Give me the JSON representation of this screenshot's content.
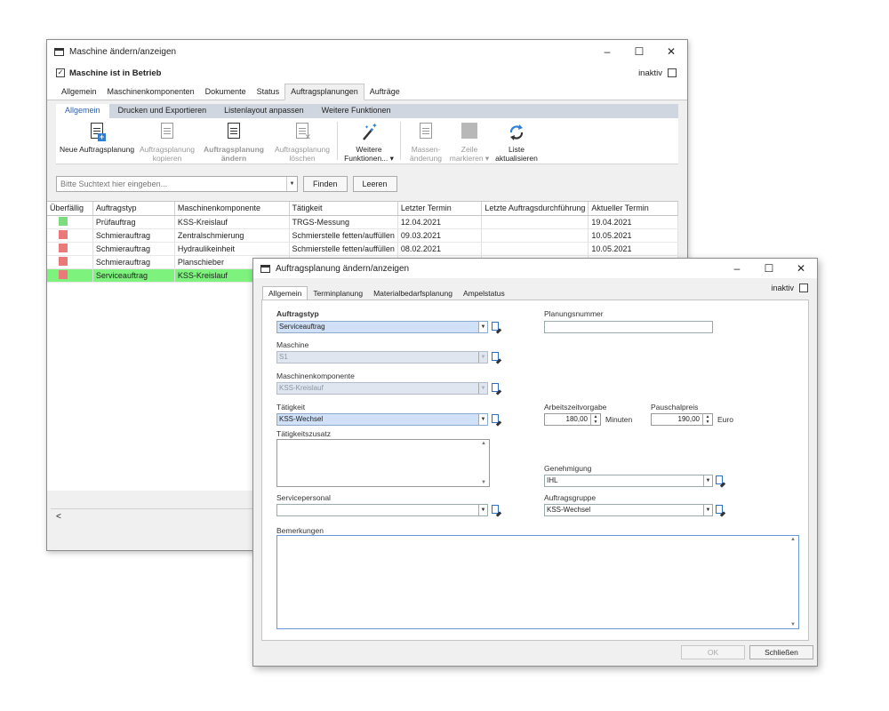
{
  "back": {
    "title": "Maschine ändern/anzeigen",
    "controls": {
      "minimize": "–",
      "maximize": "☐",
      "close": "✕"
    },
    "checkbox_label": "Maschine ist in Betrieb",
    "checkbox_checked": true,
    "inaktiv_label": "inaktiv",
    "main_tabs": [
      "Allgemein",
      "Maschinenkomponenten",
      "Dokumente",
      "Status",
      "Auftragsplanungen",
      "Aufträge"
    ],
    "main_tab_active": "Auftragsplanungen",
    "sub_tabs": [
      "Allgemein",
      "Drucken und Exportieren",
      "Listenlayout anpassen",
      "Weitere Funktionen"
    ],
    "toolbar": {
      "neue_line1": "Neue Auftragsplanung",
      "kopieren_line1": "Auftragsplanung",
      "kopieren_line2": "kopieren",
      "aendern_line1": "Auftragsplanung",
      "aendern_line2": "ändern",
      "loeschen_line1": "Auftragsplanung",
      "loeschen_line2": "löschen",
      "weitere_line1": "Weitere",
      "weitere_line2": "Funktionen... ▾",
      "massen_line1": "Massen-",
      "massen_line2": "änderung",
      "zeile_line1": "Zeile",
      "zeile_line2": "markieren ▾",
      "liste_line1": "Liste",
      "liste_line2": "aktualisieren"
    },
    "search": {
      "placeholder": "Bitte Suchtext hier eingeben...",
      "find_label": "Finden",
      "clear_label": "Leeren"
    },
    "grid": {
      "columns": [
        "Überfällig",
        "Auftragstyp",
        "Maschinenkomponente",
        "Tätigkeit",
        "Letzter Termin",
        "Letzte Auftragsdurchführung",
        "Aktueller Termin"
      ],
      "rows": [
        {
          "status": "green",
          "typ": "Prüfauftrag",
          "komp": "KSS-Kreislauf",
          "taet": "TRGS-Messung",
          "letzter": "12.04.2021",
          "durchf": "",
          "aktuell": "19.04.2021"
        },
        {
          "status": "red",
          "typ": "Schmierauftrag",
          "komp": "Zentralschmierung",
          "taet": "Schmierstelle fetten/auffüllen",
          "letzter": "09.03.2021",
          "durchf": "",
          "aktuell": "10.05.2021"
        },
        {
          "status": "red",
          "typ": "Schmierauftrag",
          "komp": "Hydraulikeinheit",
          "taet": "Schmierstelle fetten/auffüllen",
          "letzter": "08.02.2021",
          "durchf": "",
          "aktuell": "10.05.2021"
        },
        {
          "status": "red",
          "typ": "Schmierauftrag",
          "komp": "Planschieber",
          "taet": "",
          "letzter": "",
          "durchf": "",
          "aktuell": ""
        },
        {
          "status": "red",
          "typ": "Serviceauftrag",
          "komp": "KSS-Kreislauf",
          "taet": "",
          "letzter": "",
          "durchf": "",
          "aktuell": ""
        }
      ],
      "scroll_left": "<"
    },
    "colors": {
      "green": "#7ddc7d",
      "red": "#ea7a7a",
      "selected_row": "#7df27d"
    }
  },
  "front": {
    "title": "Auftragsplanung ändern/anzeigen",
    "controls": {
      "minimize": "–",
      "maximize": "☐",
      "close": "✕"
    },
    "tabs": [
      "Allgemein",
      "Terminplanung",
      "Materialbedarfsplanung",
      "Ampelstatus"
    ],
    "tab_active": "Allgemein",
    "inaktiv_label": "inaktiv",
    "fields": {
      "auftragstyp_label": "Auftragstyp",
      "auftragstyp_value": "Serviceauftrag",
      "maschine_label": "Maschine",
      "maschine_value": "S1",
      "komponente_label": "Maschinenkomponente",
      "komponente_value": "KSS-Kreislauf",
      "taetigkeit_label": "Tätigkeit",
      "taetigkeit_value": "KSS-Wechsel",
      "zusatz_label": "Tätigkeitszusatz",
      "servicepersonal_label": "Servicepersonal",
      "servicepersonal_value": "",
      "planungsnummer_label": "Planungsnummer",
      "planungsnummer_value": "",
      "arbeitszeit_label": "Arbeitszeitvorgabe",
      "arbeitszeit_value": "180,00",
      "arbeitszeit_unit": "Minuten",
      "pauschal_label": "Pauschalpreis",
      "pauschal_value": "190,00",
      "pauschal_unit": "Euro",
      "genehmigung_label": "Genehmigung",
      "genehmigung_value": "IHL",
      "auftragsgruppe_label": "Auftragsgruppe",
      "auftragsgruppe_value": "KSS-Wechsel",
      "bemerkungen_label": "Bemerkungen"
    },
    "buttons": {
      "ok": "OK",
      "close": "Schließen"
    }
  }
}
